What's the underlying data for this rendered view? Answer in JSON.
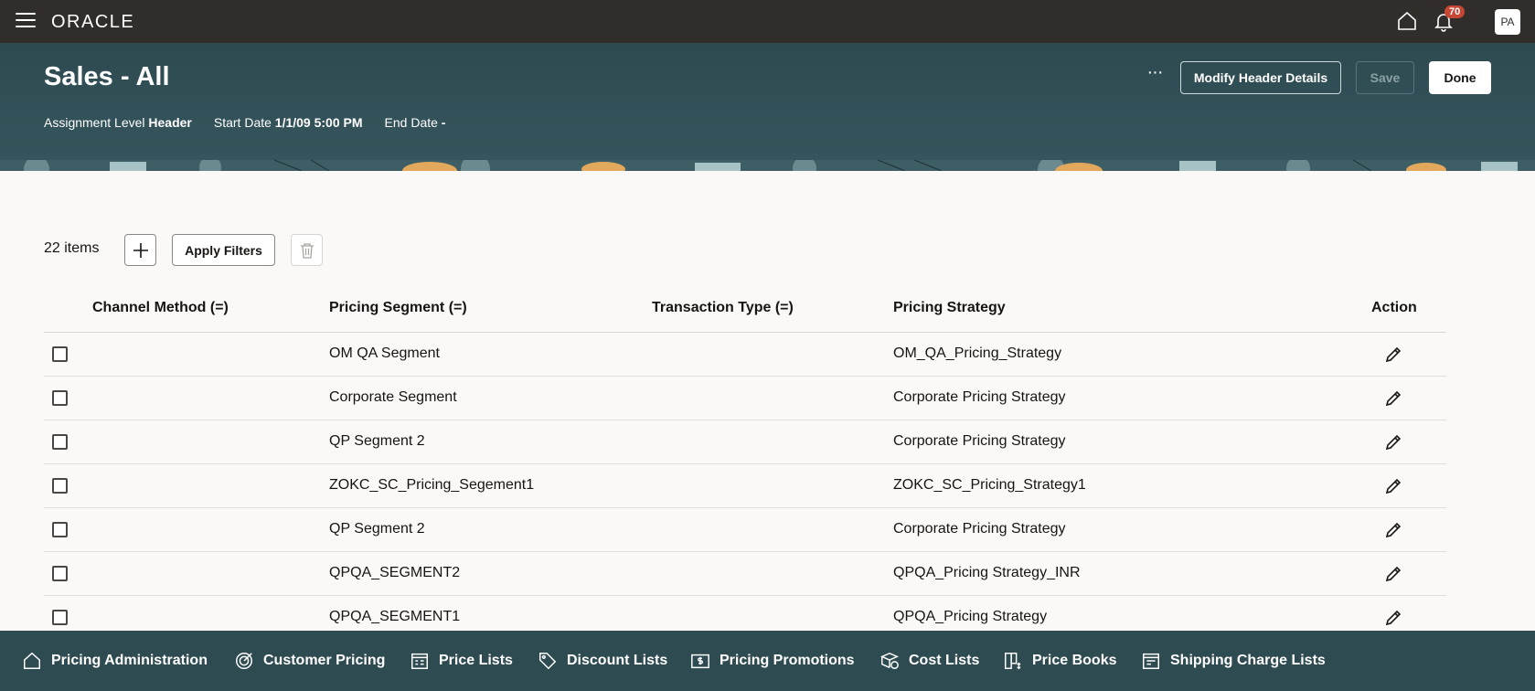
{
  "topbar": {
    "logo": "ORACLE",
    "notification_count": "70",
    "avatar_initials": "PA"
  },
  "header": {
    "title": "Sales - All",
    "assignment_label": "Assignment Level",
    "assignment_value": "Header",
    "start_label": "Start Date",
    "start_value": "1/1/09 5:00 PM",
    "end_label": "End Date",
    "end_value": "-",
    "more_label": "···",
    "modify_label": "Modify Header Details",
    "save_label": "Save",
    "done_label": "Done"
  },
  "toolbar": {
    "count": "22 items",
    "apply_label": "Apply Filters"
  },
  "table": {
    "columns": [
      "Channel Method (=)",
      "Pricing Segment (=)",
      "Transaction Type (=)",
      "Pricing Strategy",
      "Action"
    ],
    "rows": [
      {
        "channel": "",
        "segment": "OM QA Segment",
        "transaction": "",
        "strategy": "OM_QA_Pricing_Strategy"
      },
      {
        "channel": "",
        "segment": "Corporate Segment",
        "transaction": "",
        "strategy": "Corporate Pricing Strategy"
      },
      {
        "channel": "",
        "segment": "QP Segment 2",
        "transaction": "",
        "strategy": "Corporate Pricing Strategy"
      },
      {
        "channel": "",
        "segment": "ZOKC_SC_Pricing_Segement1",
        "transaction": "",
        "strategy": "ZOKC_SC_Pricing_Strategy1"
      },
      {
        "channel": "",
        "segment": "QP Segment 2",
        "transaction": "",
        "strategy": "Corporate Pricing Strategy"
      },
      {
        "channel": "",
        "segment": "QPQA_SEGMENT2",
        "transaction": "",
        "strategy": "QPQA_Pricing Strategy_INR"
      },
      {
        "channel": "",
        "segment": "QPQA_SEGMENT1",
        "transaction": "",
        "strategy": "QPQA_Pricing Strategy"
      }
    ]
  },
  "bottomnav": {
    "items": [
      {
        "label": "Pricing Administration",
        "icon": "home-icon"
      },
      {
        "label": "Customer Pricing",
        "icon": "target-icon"
      },
      {
        "label": "Price Lists",
        "icon": "price-list-icon"
      },
      {
        "label": "Discount Lists",
        "icon": "tag-icon"
      },
      {
        "label": "Pricing Promotions",
        "icon": "dollar-icon"
      },
      {
        "label": "Cost Lists",
        "icon": "cost-icon"
      },
      {
        "label": "Price Books",
        "icon": "book-icon"
      },
      {
        "label": "Shipping Charge Lists",
        "icon": "shipping-icon"
      }
    ]
  },
  "colors": {
    "topbar": "#312d2a",
    "header": "#2f4b52",
    "badge": "#c74634"
  }
}
